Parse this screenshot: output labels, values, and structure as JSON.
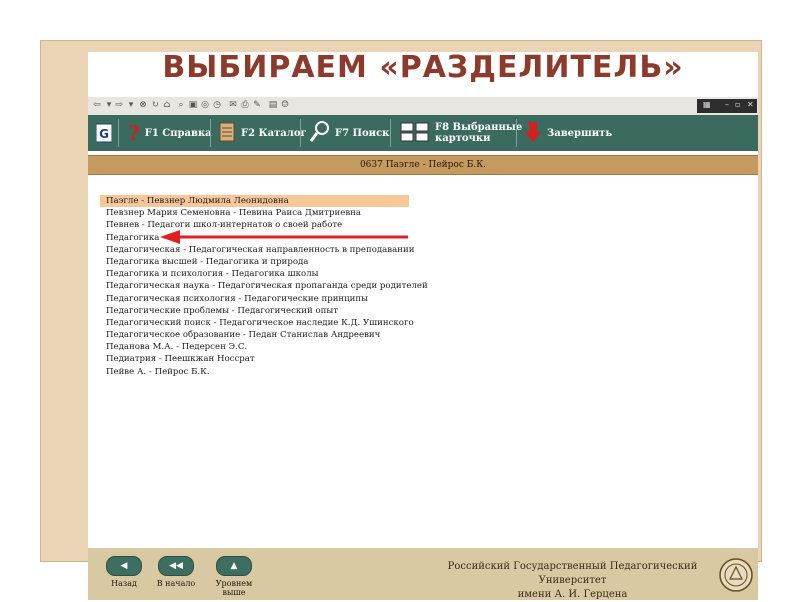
{
  "slide_title": "ВЫБИРАЕМ «РАЗДЕЛИТЕЛЬ»",
  "navbar": {
    "help": "F1 Справка",
    "catalog": "F2 Каталог",
    "search": "F7 Поиск",
    "selected_line1": "F8 Выбранные",
    "selected_line2": "карточки",
    "exit": "Завершить"
  },
  "breadcrumb": "0637 Паэгле - Пейрос Б.К.",
  "list": {
    "selected_index": 0,
    "items": [
      "Паэгле - Певзнер Людмила Леонидовна",
      "Певзнер Мария Семеновна - Певина Раиса Дмитриевна",
      "Певнев - Педагоги школ-интернатов о своей работе",
      "Педагогика",
      "Педагогическая - Педагогическая направленность в преподавании",
      "Педагогика высшей - Педагогика и природа",
      "Педагогика и психология - Педагогика школы",
      "Педагогическая наука - Педагогическая пропаганда среди родителей",
      "Педагогическая психология - Педагогические принципы",
      "Педагогические проблемы - Педагогический опыт",
      "Педагогический поиск - Педагогическое наследие К.Д. Ушинского",
      "Педагогическое образование - Педан Станислав Андреевич",
      "Педанова М.А. - Педерсен Э.С.",
      "Педиатрия - Пеешкжан Носсрат",
      "Пейве А. - Пейрос Б.К."
    ]
  },
  "footer": {
    "back": "Назад",
    "to_start": "В начало",
    "level_up_line1": "Уровнем",
    "level_up_line2": "выше",
    "university_line1": "Российский Государственный Педагогический Университет",
    "university_line2": "имени А. И. Герцена"
  },
  "colors": {
    "title": "#8b3a2b",
    "navbar": "#3b6b5f",
    "breadcrumb": "#c49a5f",
    "selected_row": "#f7c79a",
    "arrow": "#e02020"
  }
}
